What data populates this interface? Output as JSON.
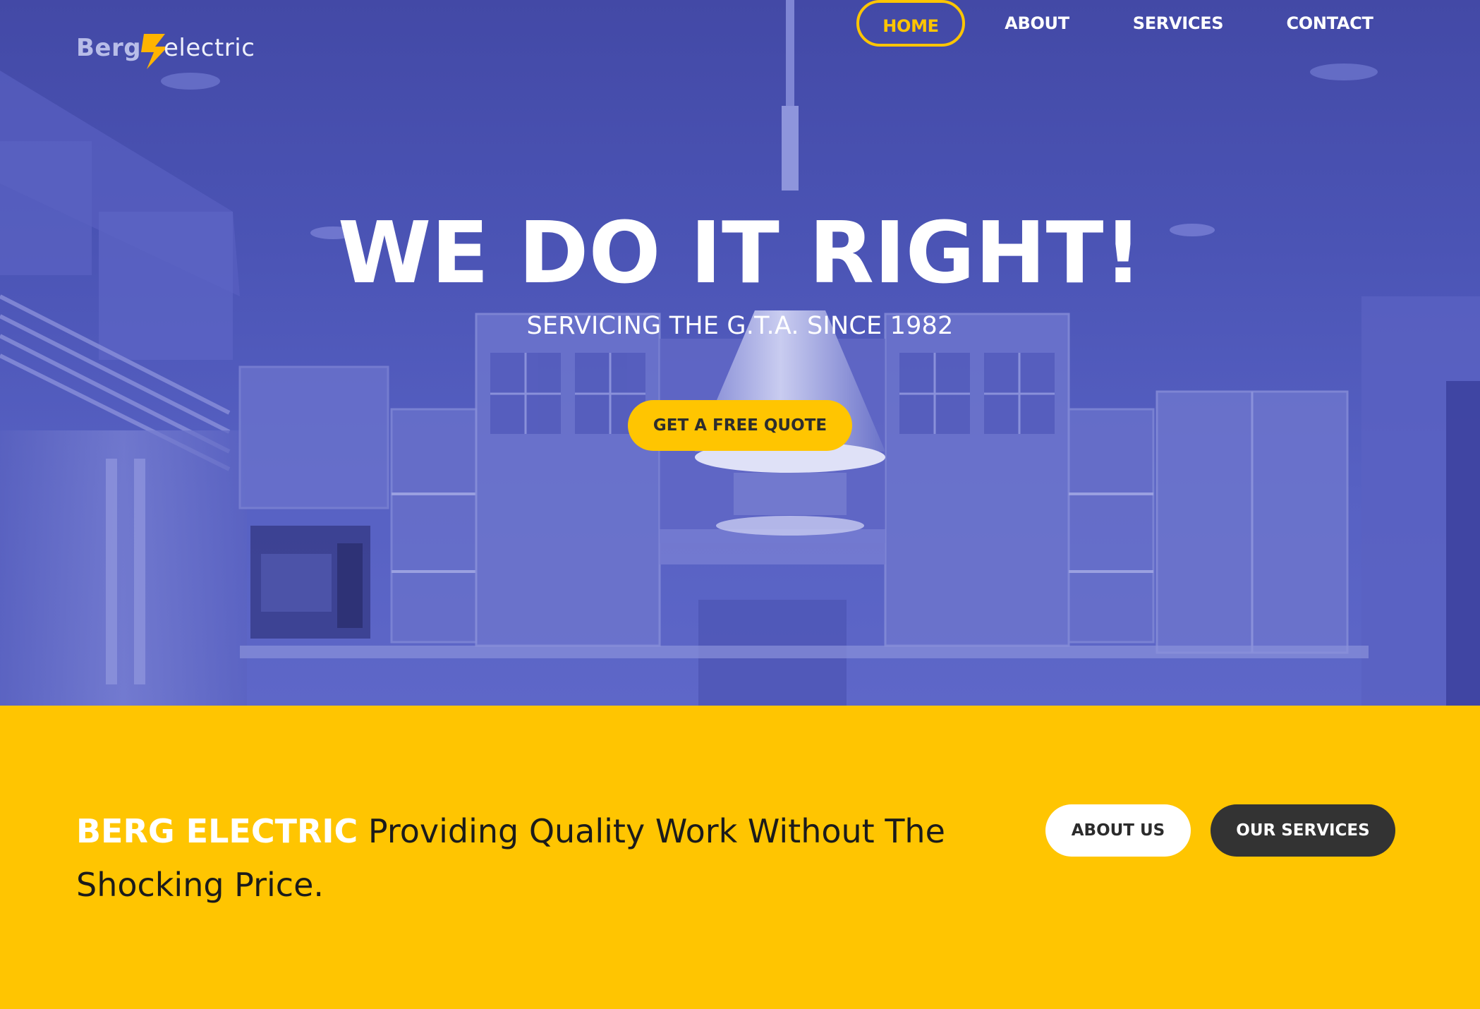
{
  "brand": {
    "logo_primary": "Berg",
    "logo_secondary": "electric",
    "bolt_icon": "lightning-bolt-icon"
  },
  "nav": {
    "items": [
      {
        "label": "HOME",
        "active": true
      },
      {
        "label": "ABOUT",
        "active": false
      },
      {
        "label": "SERVICES",
        "active": false
      },
      {
        "label": "CONTACT",
        "active": false
      }
    ]
  },
  "hero": {
    "title": "WE DO IT RIGHT!",
    "subtitle": "SERVICING THE G.T.A. SINCE 1982",
    "cta_label": "GET A FREE QUOTE",
    "background": "blue-tinted kitchen photo"
  },
  "band": {
    "tagline_brand": "BERG ELECTRIC",
    "tagline_text": "Providing Quality Work Without The Shocking Price.",
    "about_button": "ABOUT US",
    "services_button": "OUR SERVICES"
  },
  "colors": {
    "accent": "#ffc501",
    "hero_overlay": "#4b54b5",
    "dark_button": "#333333",
    "white": "#ffffff"
  }
}
